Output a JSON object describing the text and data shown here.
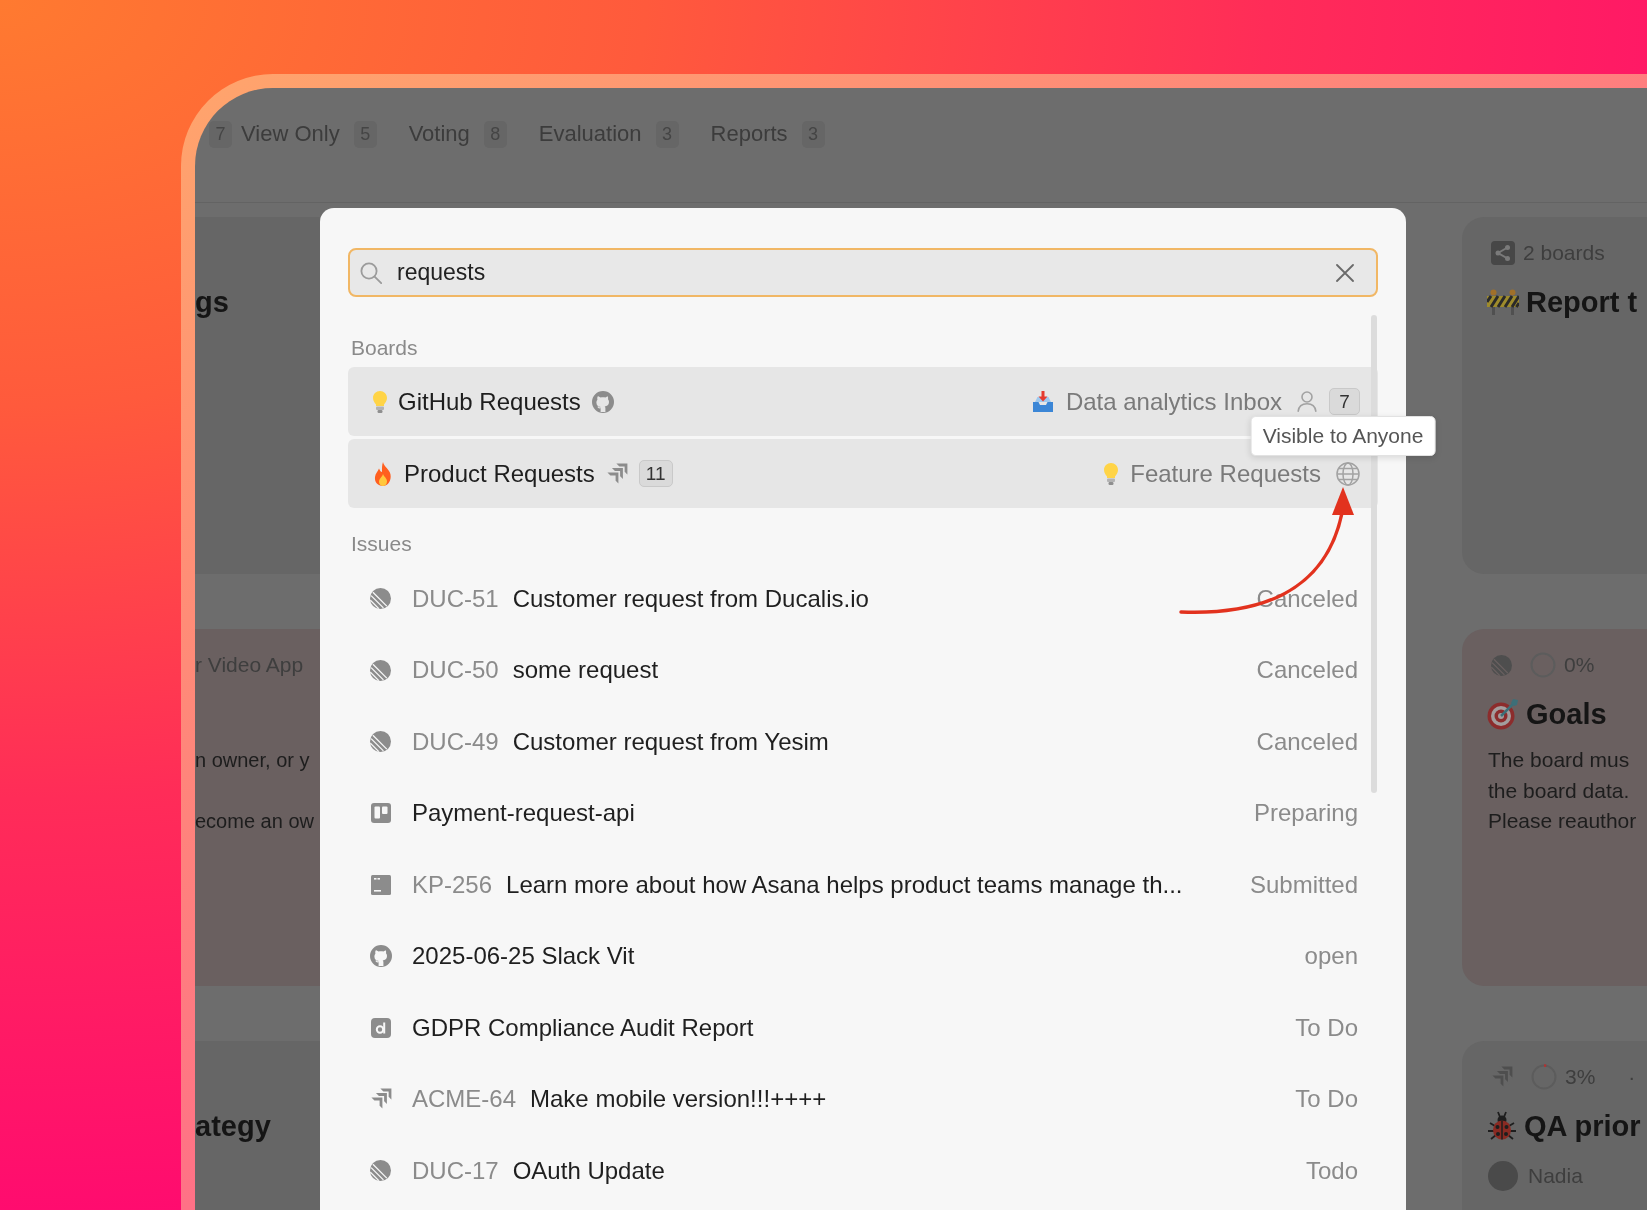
{
  "background": {
    "tabs": [
      {
        "count": "7"
      },
      {
        "label": "View Only",
        "count": "5"
      },
      {
        "label": "Voting",
        "count": "8"
      },
      {
        "label": "Evaluation",
        "count": "3"
      },
      {
        "label": "Reports",
        "count": "3"
      }
    ],
    "left_cards": [
      {
        "kind": "normal",
        "title": {
          "text": "gs"
        }
      },
      {
        "kind": "error",
        "meta": {
          "text": "r Video App"
        },
        "description": [
          "n owner, or y",
          "ecome an ow"
        ]
      },
      {
        "kind": "normal",
        "title": {
          "text": "ategy"
        }
      }
    ],
    "right_cards": [
      {
        "kind": "normal",
        "meta": {
          "text": "2 boards"
        },
        "title": {
          "text": "Report t"
        }
      },
      {
        "kind": "error",
        "meta": {
          "progress": "0%"
        },
        "title": {
          "text": "Goals"
        },
        "description": [
          "The board mus",
          "the board data.",
          "Please reauthor"
        ]
      },
      {
        "kind": "normal",
        "meta": {
          "progress": "3%",
          "separator": "·"
        },
        "title": {
          "text": "QA prior"
        },
        "owner": {
          "name": "Nadia"
        }
      }
    ]
  },
  "modal": {
    "search": {
      "value": "requests"
    },
    "boards": {
      "heading": "Boards",
      "rows": [
        {
          "name": "GitHub Requests",
          "target": "Data analytics Inbox",
          "public": false,
          "access_count": "7"
        },
        {
          "name": "Product Requests",
          "count": "11",
          "target": "Feature Requests",
          "public": true,
          "tooltip": "Visible to Anyone"
        }
      ]
    },
    "issues": {
      "heading": "Issues",
      "rows": [
        {
          "kind": "linear",
          "key": "DUC-51",
          "title": "Customer request from Ducalis.io",
          "status": "Canceled"
        },
        {
          "kind": "linear",
          "key": "DUC-50",
          "title": "some request",
          "status": "Canceled"
        },
        {
          "kind": "linear",
          "key": "DUC-49",
          "title": "Customer request from Yesim",
          "status": "Canceled"
        },
        {
          "kind": "trello",
          "title": "Payment-request-api",
          "status": "Preparing"
        },
        {
          "kind": "youtrack",
          "key": "KP-256",
          "title": "Learn more about how Asana helps product teams manage th...",
          "status": "Submitted"
        },
        {
          "kind": "github",
          "title": "2025-06-25 Slack Vit",
          "status": "open"
        },
        {
          "kind": "doc",
          "title": "GDPR Compliance Audit Report",
          "status": "To Do"
        },
        {
          "kind": "jira",
          "key": "ACME-64",
          "title": "Make mobile version!!!++++",
          "status": "To Do"
        },
        {
          "kind": "linear",
          "key": "DUC-17",
          "title": "OAuth Update",
          "status": "Todo"
        }
      ]
    },
    "annotations": [
      {
        "kind": "arrow"
      }
    ]
  }
}
